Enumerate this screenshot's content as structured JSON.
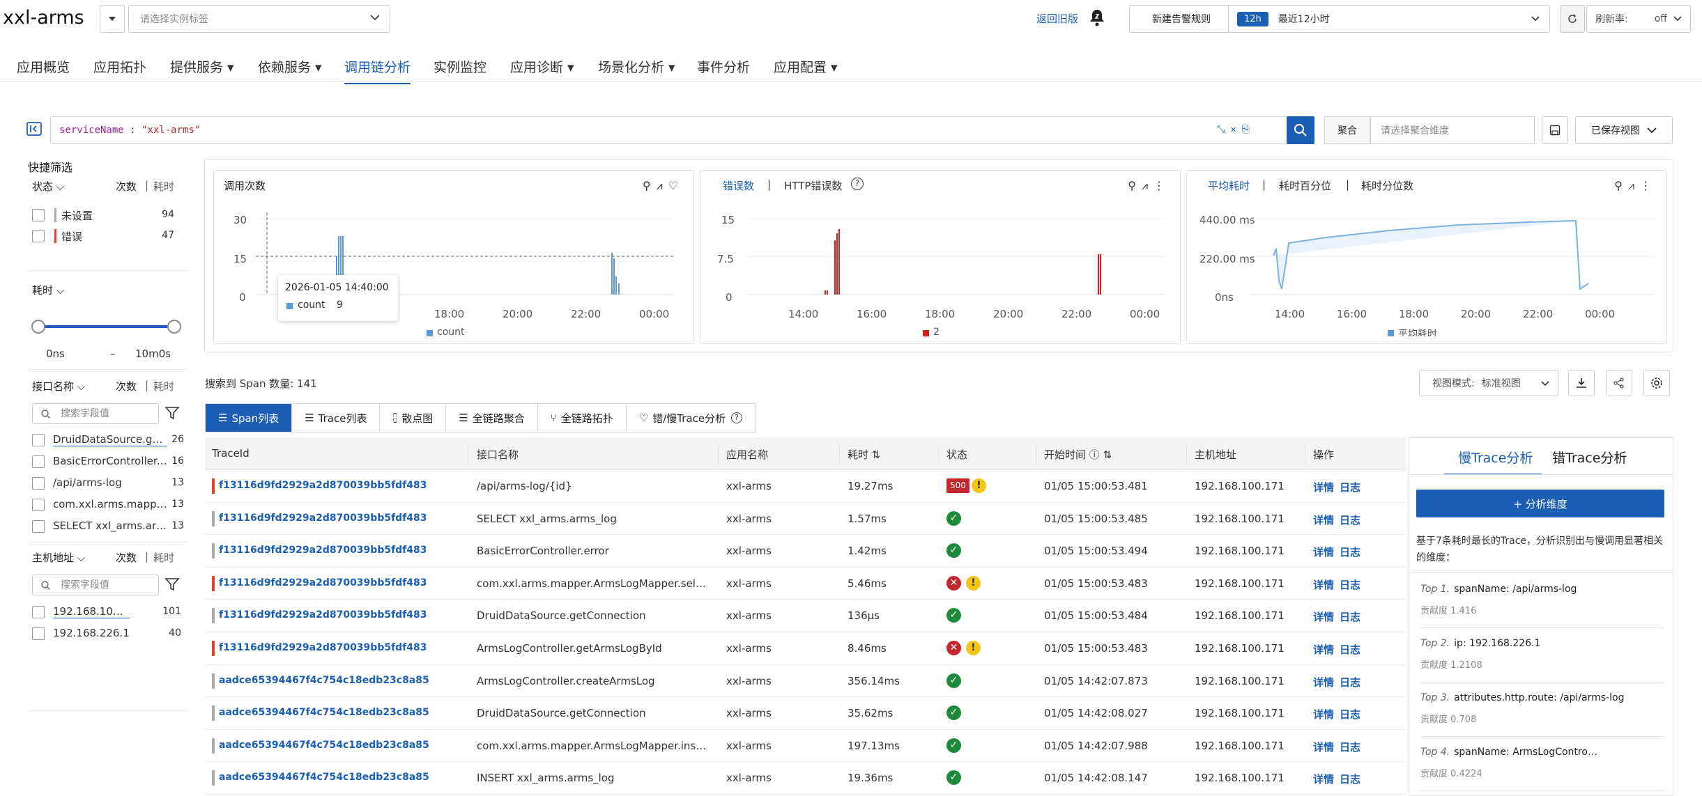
{
  "header": {
    "app_name": "xxl-arms",
    "tag_placeholder": "请选择实例标签",
    "back_old": "返回旧版",
    "new_alert": "新建告警规则",
    "time_badge": "12h",
    "time_range": "最近12小时",
    "refresh_label": "刷新率:",
    "refresh_value": "off"
  },
  "nav": [
    {
      "label": "应用概览"
    },
    {
      "label": "应用拓扑"
    },
    {
      "label": "提供服务",
      "dropdown": true
    },
    {
      "label": "依赖服务",
      "dropdown": true
    },
    {
      "label": "调用链分析",
      "active": true
    },
    {
      "label": "实例监控"
    },
    {
      "label": "应用诊断",
      "dropdown": true
    },
    {
      "label": "场景化分析",
      "dropdown": true
    },
    {
      "label": "事件分析"
    },
    {
      "label": "应用配置",
      "dropdown": true
    }
  ],
  "query": {
    "key": "serviceName",
    "sep": " : ",
    "value": "\"xxl-arms\""
  },
  "aggregate": {
    "label": "聚合",
    "placeholder": "请选择聚合维度",
    "saved_view": "已保存视图"
  },
  "sidebar": {
    "quick_filter": "快捷筛选",
    "status": {
      "title": "状态",
      "col_count": "次数",
      "col_sep": "|",
      "col_time": "耗时",
      "items": [
        {
          "label": "未设置",
          "count": "94",
          "color": "#aaaaaa"
        },
        {
          "label": "错误",
          "count": "47",
          "color": "#e0432b"
        }
      ]
    },
    "duration": {
      "title": "耗时",
      "min": "0ns",
      "dash": "–",
      "max": "10m0s"
    },
    "endpoint": {
      "title": "接口名称",
      "col_count": "次数",
      "col_sep": "|",
      "col_time": "耗时",
      "search": "搜索字段值",
      "items": [
        {
          "label": "DruidDataSource.get…",
          "count": "26"
        },
        {
          "label": "BasicErrorController.…",
          "count": "16"
        },
        {
          "label": "/api/arms-log",
          "count": "13"
        },
        {
          "label": "com.xxl.arms.mapper…",
          "count": "13"
        },
        {
          "label": "SELECT xxl_arms.arm…",
          "count": "13"
        }
      ]
    },
    "host": {
      "title": "主机地址",
      "col_count": "次数",
      "col_sep": "|",
      "col_time": "耗时",
      "search": "搜索字段值",
      "items": [
        {
          "label": "192.168.100.171",
          "count": "101"
        },
        {
          "label": "192.168.226.1",
          "count": "40"
        }
      ]
    }
  },
  "charts": {
    "calls": {
      "title": "调用次数",
      "y_ticks": [
        "30",
        "15",
        "0"
      ],
      "x_ticks": [
        "18:00",
        "20:00",
        "22:00",
        "00:00"
      ],
      "legend": "count",
      "tooltip_time": "2026-01-05 14:40:00",
      "tooltip_label": "count",
      "tooltip_value": "9",
      "color": "#5b9bd5"
    },
    "errors": {
      "title_active": "错误数",
      "title_sep": "|",
      "title_other": "HTTP错误数",
      "y_ticks": [
        "15",
        "7.5",
        "0"
      ],
      "x_ticks": [
        "14:00",
        "16:00",
        "18:00",
        "20:00",
        "22:00",
        "00:00"
      ],
      "legend": "2",
      "color": "#d11f1f"
    },
    "latency": {
      "title_active": "平均耗时",
      "title_sep1": "|",
      "title_mid": "耗时百分位",
      "title_sep2": "|",
      "title_other": "耗时分位数",
      "y_ticks": [
        "440.00 ms",
        "220.00 ms",
        "0ns"
      ],
      "x_ticks": [
        "14:00",
        "16:00",
        "18:00",
        "20:00",
        "22:00",
        "00:00"
      ],
      "legend": "平均耗时",
      "color": "#5b9bd5"
    }
  },
  "chart_data": [
    {
      "type": "bar",
      "title": "调用次数",
      "series": [
        {
          "name": "count",
          "values": [
            {
              "x": "14:40",
              "y": 9
            }
          ]
        }
      ],
      "ylim": [
        0,
        30
      ]
    },
    {
      "type": "bar",
      "title": "错误数",
      "series": [
        {
          "name": "2"
        }
      ],
      "ylim": [
        0,
        15
      ]
    },
    {
      "type": "area",
      "title": "平均耗时",
      "series": [
        {
          "name": "平均耗时"
        }
      ],
      "ylim": [
        0,
        440
      ]
    }
  ],
  "spans": {
    "count_text": "搜索到 Span 数量: 141",
    "view_mode_label": "视图模式:",
    "view_mode_value": "标准视图",
    "tabs": [
      {
        "label": "Span列表",
        "active": true
      },
      {
        "label": "Trace列表"
      },
      {
        "label": "散点图"
      },
      {
        "label": "全链路聚合"
      },
      {
        "label": "全链路拓扑"
      },
      {
        "label": "错/慢Trace分析"
      }
    ],
    "columns": [
      "TraceId",
      "接口名称",
      "应用名称",
      "耗时",
      "状态",
      "开始时间",
      "主机地址",
      "操作"
    ],
    "op_detail": "详情",
    "op_log": "日志",
    "rows": [
      {
        "trace": "f13116d9fd2929a2d870039bb5fdf483",
        "stripe": "#e0432b",
        "endpoint": "/api/arms-log/{id}",
        "app": "xxl-arms",
        "dur": "19.27ms",
        "status": "500w",
        "start": "01/05 15:00:53.481",
        "host": "192.168.100.171"
      },
      {
        "trace": "f13116d9fd2929a2d870039bb5fdf483",
        "stripe": "#aaaaaa",
        "endpoint": "SELECT xxl_arms.arms_log",
        "app": "xxl-arms",
        "dur": "1.57ms",
        "status": "ok",
        "start": "01/05 15:00:53.485",
        "host": "192.168.100.171"
      },
      {
        "trace": "f13116d9fd2929a2d870039bb5fdf483",
        "stripe": "#aaaaaa",
        "endpoint": "BasicErrorController.error",
        "app": "xxl-arms",
        "dur": "1.42ms",
        "status": "ok",
        "start": "01/05 15:00:53.494",
        "host": "192.168.100.171"
      },
      {
        "trace": "f13116d9fd2929a2d870039bb5fdf483",
        "stripe": "#e0432b",
        "endpoint": "com.xxl.arms.mapper.ArmsLogMapper.select…",
        "app": "xxl-arms",
        "dur": "5.46ms",
        "status": "errw",
        "start": "01/05 15:00:53.483",
        "host": "192.168.100.171"
      },
      {
        "trace": "f13116d9fd2929a2d870039bb5fdf483",
        "stripe": "#aaaaaa",
        "endpoint": "DruidDataSource.getConnection",
        "app": "xxl-arms",
        "dur": "136µs",
        "status": "ok",
        "start": "01/05 15:00:53.484",
        "host": "192.168.100.171"
      },
      {
        "trace": "f13116d9fd2929a2d870039bb5fdf483",
        "stripe": "#e0432b",
        "endpoint": "ArmsLogController.getArmsLogById",
        "app": "xxl-arms",
        "dur": "8.46ms",
        "status": "errw",
        "start": "01/05 15:00:53.483",
        "host": "192.168.100.171"
      },
      {
        "trace": "aadce65394467f4c754c18edb23c8a85",
        "stripe": "#aaaaaa",
        "endpoint": "ArmsLogController.createArmsLog",
        "app": "xxl-arms",
        "dur": "356.14ms",
        "status": "ok",
        "start": "01/05 14:42:07.873",
        "host": "192.168.100.171"
      },
      {
        "trace": "aadce65394467f4c754c18edb23c8a85",
        "stripe": "#aaaaaa",
        "endpoint": "DruidDataSource.getConnection",
        "app": "xxl-arms",
        "dur": "35.62ms",
        "status": "ok",
        "start": "01/05 14:42:08.027",
        "host": "192.168.100.171"
      },
      {
        "trace": "aadce65394467f4c754c18edb23c8a85",
        "stripe": "#aaaaaa",
        "endpoint": "com.xxl.arms.mapper.ArmsLogMapper.insert",
        "app": "xxl-arms",
        "dur": "197.13ms",
        "status": "ok",
        "start": "01/05 14:42:07.988",
        "host": "192.168.100.171"
      },
      {
        "trace": "aadce65394467f4c754c18edb23c8a85",
        "stripe": "#aaaaaa",
        "endpoint": "INSERT xxl_arms.arms_log",
        "app": "xxl-arms",
        "dur": "19.36ms",
        "status": "ok",
        "start": "01/05 14:42:08.147",
        "host": "192.168.100.171"
      }
    ]
  },
  "analysis": {
    "tab_slow": "慢Trace分析",
    "tab_err": "错Trace分析",
    "button": "+ 分析维度",
    "desc": "基于7条耗时最长的Trace，分析识别出与慢调用显著相关的维度：",
    "items": [
      {
        "rank": "Top 1.",
        "text": "spanName: /api/arms-log",
        "score": "贡献度 1.416"
      },
      {
        "rank": "Top 2.",
        "text": "ip: 192.168.226.1",
        "score": "贡献度 1.2108"
      },
      {
        "rank": "Top 3.",
        "text": "attributes.http.route: /api/arms-log",
        "score": "贡献度 0.708"
      },
      {
        "rank": "Top 4.",
        "text": "spanName: ArmsLogContro…",
        "score": "贡献度 0.4224"
      }
    ]
  }
}
